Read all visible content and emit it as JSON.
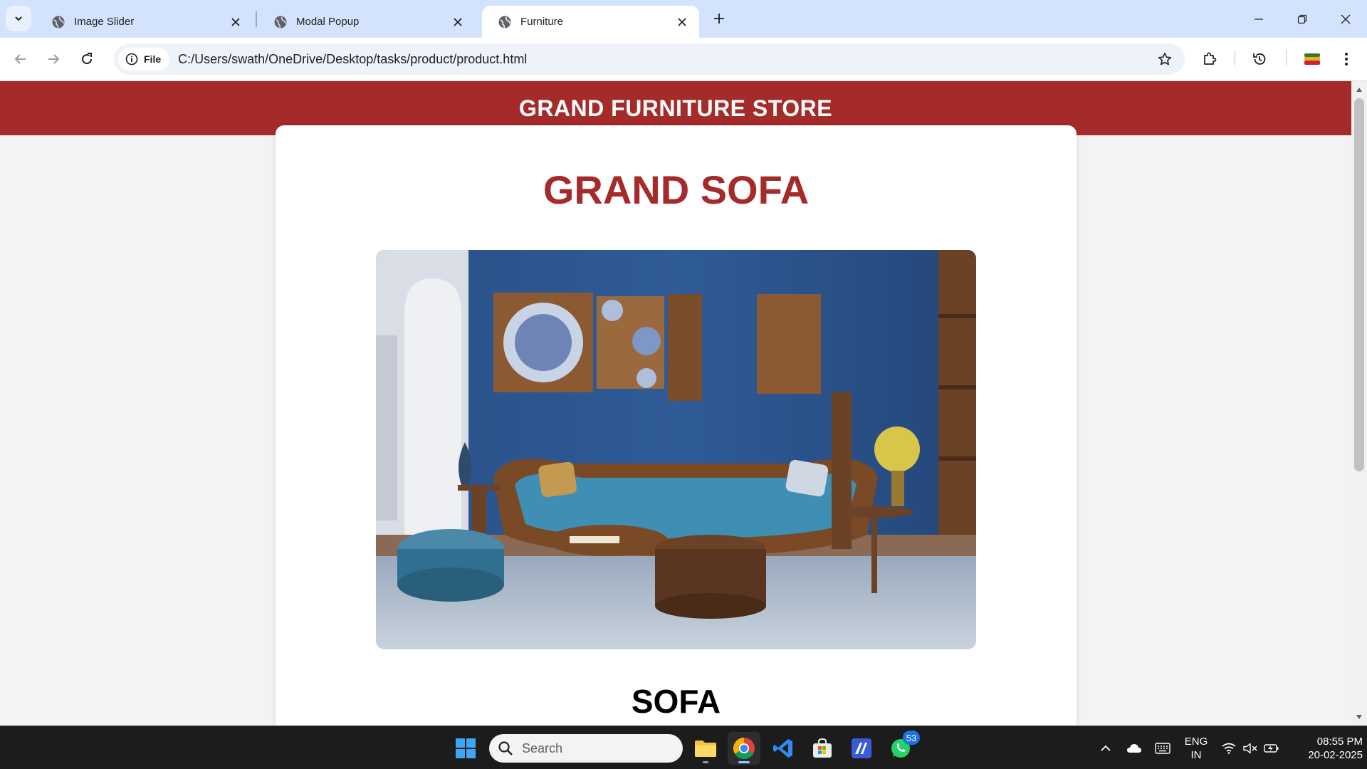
{
  "browser": {
    "tabs": [
      {
        "title": "Image Slider",
        "active": false
      },
      {
        "title": "Modal Popup",
        "active": false
      },
      {
        "title": "Furniture",
        "active": true
      }
    ],
    "site_info_label": "File",
    "url": "C:/Users/swath/OneDrive/Desktop/tasks/product/product.html"
  },
  "page": {
    "store_name": "GRAND FURNITURE STORE",
    "product_title": "GRAND SOFA",
    "product_subtitle": "SOFA",
    "colors": {
      "brand": "#a52a2a",
      "card": "#ffffff",
      "background": "#f3f3f3"
    }
  },
  "taskbar": {
    "search_placeholder": "Search",
    "whatsapp_badge": "53",
    "language_line1": "ENG",
    "language_line2": "IN",
    "time": "08:55 PM",
    "date": "20-02-2025"
  }
}
